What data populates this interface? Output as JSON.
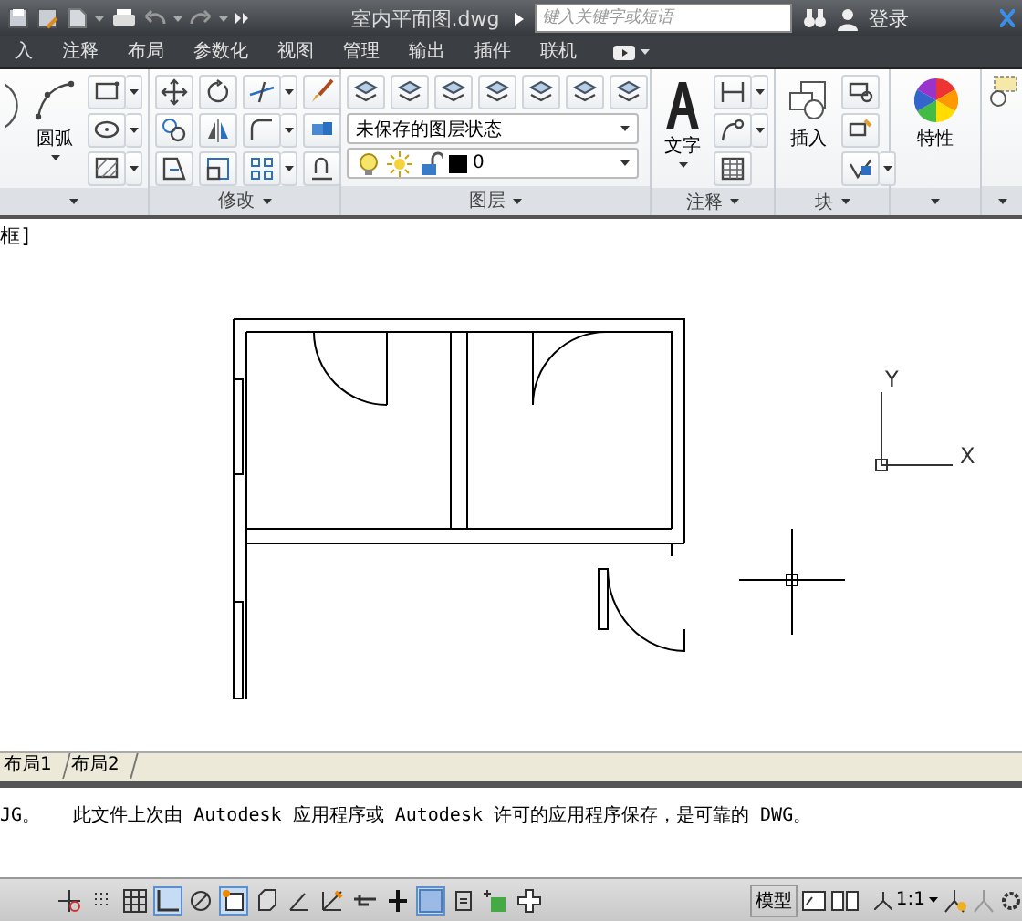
{
  "title_bar": {
    "title": "室内平面图.dwg",
    "search": {
      "placeholder": "键入关键字或短语"
    },
    "login": "登录"
  },
  "ribbon_tabs": [
    {
      "label": "入",
      "selected": false
    },
    {
      "label": "注释",
      "selected": false
    },
    {
      "label": "布局",
      "selected": false
    },
    {
      "label": "参数化",
      "selected": false
    },
    {
      "label": "视图",
      "selected": false
    },
    {
      "label": "管理",
      "selected": false
    },
    {
      "label": "输出",
      "selected": false
    },
    {
      "label": "插件",
      "selected": false
    },
    {
      "label": "联机",
      "selected": false
    }
  ],
  "ribbon": {
    "draw": {
      "arc_label": "圆弧"
    },
    "modify": {
      "label": "修改"
    },
    "layers": {
      "label": "图层",
      "layer_state": "未保存的图层状态",
      "current_layer": "0"
    },
    "annotation": {
      "label": "注释",
      "text_label": "文字"
    },
    "block": {
      "label": "块",
      "insert_label": "插入"
    },
    "properties": {
      "label": "特性"
    }
  },
  "drawing": {
    "viewport_label": "框]",
    "ucs": {
      "y": "Y",
      "x": "X"
    }
  },
  "layout_tabs": [
    {
      "label": "布局1",
      "selected": false
    },
    {
      "label": "布局2",
      "selected": false
    }
  ],
  "command_line": {
    "history": "JG。   此文件上次由 Autodesk 应用程序或 Autodesk 许可的应用程序保存，是可靠的 DWG。"
  },
  "status_bar": {
    "toggles": [
      {
        "on": false
      },
      {
        "on": false
      },
      {
        "on": false
      },
      {
        "on": true
      },
      {
        "on": false
      },
      {
        "on": true
      },
      {
        "on": false
      },
      {
        "on": false
      },
      {
        "on": false
      },
      {
        "on": false
      },
      {
        "on": false
      },
      {
        "on": true
      },
      {
        "on": false
      },
      {
        "on": false
      },
      {
        "on": false
      }
    ],
    "model": "模型",
    "scale": "1:1"
  }
}
